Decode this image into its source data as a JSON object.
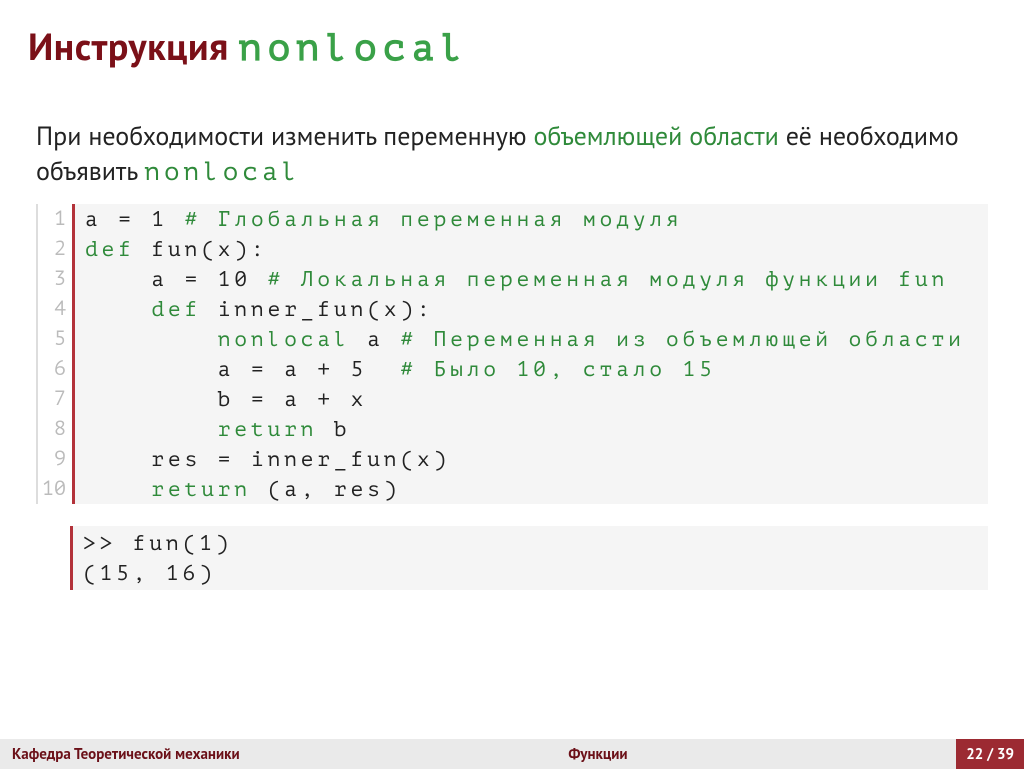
{
  "title": {
    "prefix": "Инструкция ",
    "keyword": "nonlocal"
  },
  "intro": {
    "part1": "При необходимости изменить переменную ",
    "green1": "объемлющей области",
    "part2": " её необходимо объявить ",
    "mono": "nonlocal"
  },
  "code": [
    {
      "n": 1,
      "pre": "",
      "kw": "",
      "mid": "a = 1 ",
      "cm": "# Глобальная переменная модуля"
    },
    {
      "n": 2,
      "pre": "",
      "kw": "def",
      "mid": " fun(x):",
      "cm": ""
    },
    {
      "n": 3,
      "pre": "    ",
      "kw": "",
      "mid": "a = 10 ",
      "cm": "# Локальная переменная модуля функции fun"
    },
    {
      "n": 4,
      "pre": "    ",
      "kw": "def",
      "mid": " inner_fun(x):",
      "cm": ""
    },
    {
      "n": 5,
      "pre": "        ",
      "kw": "nonlocal",
      "mid": " a ",
      "cm": "# Переменная из объемлющей области"
    },
    {
      "n": 6,
      "pre": "        ",
      "kw": "",
      "mid": "a = a + 5  ",
      "cm": "# Было 10, стало 15"
    },
    {
      "n": 7,
      "pre": "        ",
      "kw": "",
      "mid": "b = a + x",
      "cm": ""
    },
    {
      "n": 8,
      "pre": "        ",
      "kw": "return",
      "mid": " b",
      "cm": ""
    },
    {
      "n": 9,
      "pre": "    ",
      "kw": "",
      "mid": "res = inner_fun(x)",
      "cm": ""
    },
    {
      "n": 10,
      "pre": "    ",
      "kw": "return",
      "mid": " (a, res)",
      "cm": ""
    }
  ],
  "output": {
    "line1": ">> fun(1)",
    "line2": "(15, 16)"
  },
  "footer": {
    "left": "Кафедра Теоретической механики",
    "center": "Функции",
    "page": "22 / 39"
  }
}
